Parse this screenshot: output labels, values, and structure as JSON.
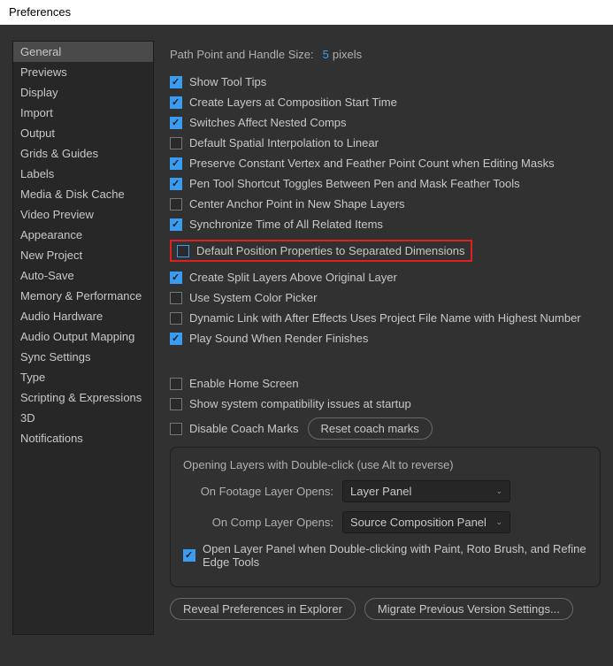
{
  "title": "Preferences",
  "sidebar": {
    "items": [
      {
        "label": "General",
        "selected": true
      },
      {
        "label": "Previews"
      },
      {
        "label": "Display"
      },
      {
        "label": "Import"
      },
      {
        "label": "Output"
      },
      {
        "label": "Grids & Guides"
      },
      {
        "label": "Labels"
      },
      {
        "label": "Media & Disk Cache"
      },
      {
        "label": "Video Preview"
      },
      {
        "label": "Appearance"
      },
      {
        "label": "New Project"
      },
      {
        "label": "Auto-Save"
      },
      {
        "label": "Memory & Performance"
      },
      {
        "label": "Audio Hardware"
      },
      {
        "label": "Audio Output Mapping"
      },
      {
        "label": "Sync Settings"
      },
      {
        "label": "Type"
      },
      {
        "label": "Scripting & Expressions"
      },
      {
        "label": "3D"
      },
      {
        "label": "Notifications"
      }
    ]
  },
  "pathPoint": {
    "label_prefix": "Path Point and Handle Size:",
    "value": "5",
    "unit": "pixels"
  },
  "checks": [
    {
      "label": "Show Tool Tips",
      "checked": true
    },
    {
      "label": "Create Layers at Composition Start Time",
      "checked": true
    },
    {
      "label": "Switches Affect Nested Comps",
      "checked": true
    },
    {
      "label": "Default Spatial Interpolation to Linear",
      "checked": false
    },
    {
      "label": "Preserve Constant Vertex and Feather Point Count when Editing Masks",
      "checked": true
    },
    {
      "label": "Pen Tool Shortcut Toggles Between Pen and Mask Feather Tools",
      "checked": true
    },
    {
      "label": "Center Anchor Point in New Shape Layers",
      "checked": false
    },
    {
      "label": "Synchronize Time of All Related Items",
      "checked": true
    },
    {
      "label": "Default Position Properties to Separated Dimensions",
      "checked": false,
      "highlight": true
    },
    {
      "label": "Create Split Layers Above Original Layer",
      "checked": true
    },
    {
      "label": "Use System Color Picker",
      "checked": false
    },
    {
      "label": "Dynamic Link with After Effects Uses Project File Name with Highest Number",
      "checked": false
    },
    {
      "label": "Play Sound When Render Finishes",
      "checked": true
    }
  ],
  "checks2": [
    {
      "label": "Enable Home Screen",
      "checked": false
    },
    {
      "label": "Show system compatibility issues at startup",
      "checked": false
    },
    {
      "label": "Disable Coach Marks",
      "checked": false
    }
  ],
  "resetCoach": "Reset coach marks",
  "group": {
    "title": "Opening Layers with Double-click (use Alt to reverse)",
    "footageLabel": "On Footage Layer Opens:",
    "footageValue": "Layer Panel",
    "compLabel": "On Comp Layer Opens:",
    "compValue": "Source Composition Panel",
    "doubleClick": {
      "label": "Open Layer Panel when Double-clicking with Paint, Roto Brush, and Refine Edge Tools",
      "checked": true
    }
  },
  "bottom": {
    "reveal": "Reveal Preferences in Explorer",
    "migrate": "Migrate Previous Version Settings..."
  }
}
